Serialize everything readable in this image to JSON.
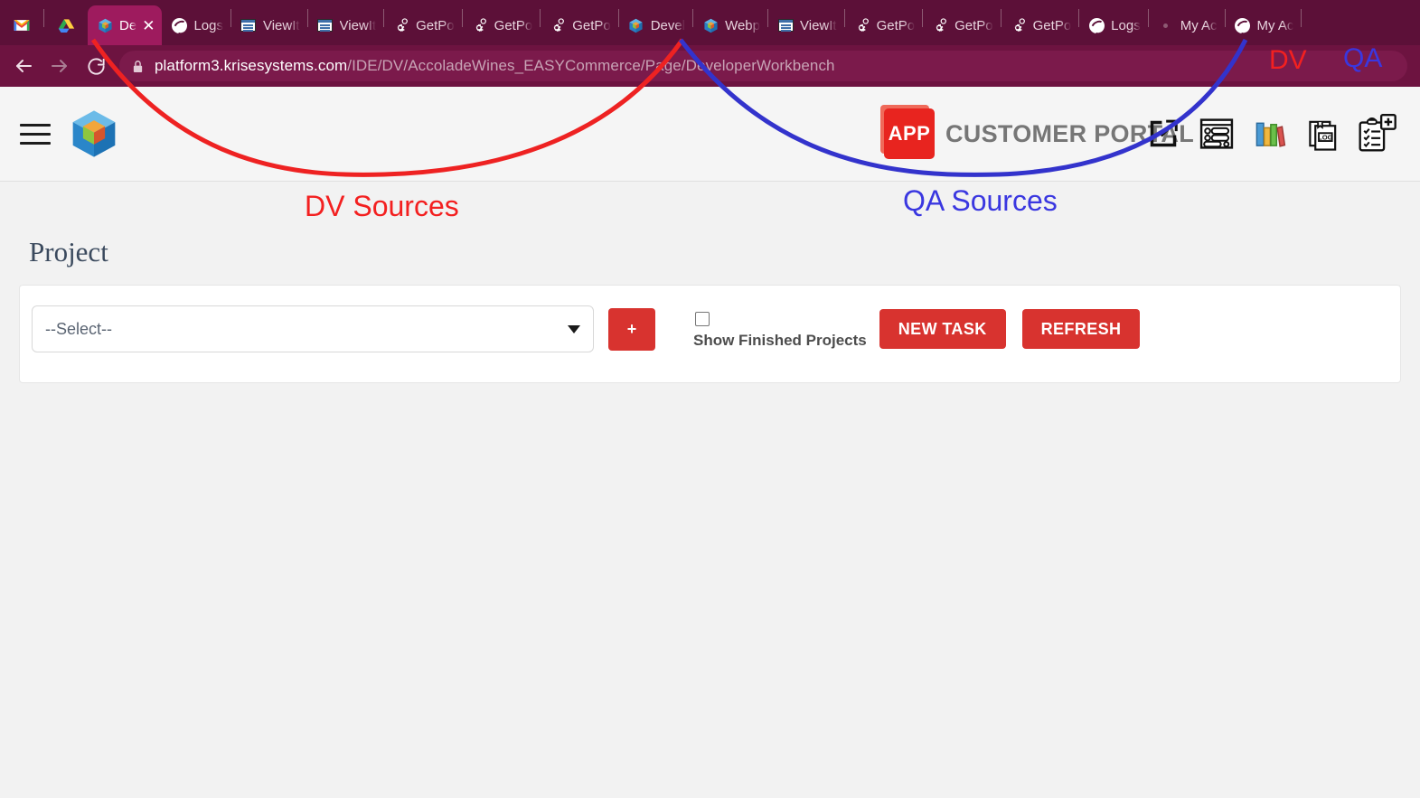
{
  "browser": {
    "quick_icons": [
      {
        "name": "gmail-icon",
        "label": "Gmail"
      },
      {
        "name": "google-drive-icon",
        "label": "Google Drive"
      }
    ],
    "tabs": [
      {
        "title": "De",
        "favicon": "cube-icon",
        "active": true,
        "has_close": true
      },
      {
        "title": "Logs",
        "favicon": "globe-icon",
        "active": false,
        "has_close": false
      },
      {
        "title": "ViewIt",
        "favicon": "window-icon",
        "active": false,
        "has_close": false
      },
      {
        "title": "ViewIt",
        "favicon": "window-icon",
        "active": false,
        "has_close": false
      },
      {
        "title": "GetPo",
        "favicon": "gear-icon",
        "active": false,
        "has_close": false
      },
      {
        "title": "GetPo",
        "favicon": "gear-icon",
        "active": false,
        "has_close": false
      },
      {
        "title": "GetPo",
        "favicon": "gear-icon",
        "active": false,
        "has_close": false
      },
      {
        "title": "Devel",
        "favicon": "cube-icon",
        "active": false,
        "has_close": false
      },
      {
        "title": "Webp",
        "favicon": "cube-icon",
        "active": false,
        "has_close": false
      },
      {
        "title": "ViewIt",
        "favicon": "window-icon",
        "active": false,
        "has_close": false
      },
      {
        "title": "GetPo",
        "favicon": "gear-icon",
        "active": false,
        "has_close": false
      },
      {
        "title": "GetPo",
        "favicon": "gear-icon",
        "active": false,
        "has_close": false
      },
      {
        "title": "GetPo",
        "favicon": "gear-icon",
        "active": false,
        "has_close": false
      },
      {
        "title": "Logs",
        "favicon": "globe-icon",
        "active": false,
        "has_close": false
      },
      {
        "title": "My Ac",
        "favicon": "dot-icon",
        "active": false,
        "has_close": false
      },
      {
        "title": "My Ac",
        "favicon": "globe-icon",
        "active": false,
        "has_close": false
      }
    ],
    "nav": {
      "back_label": "Back",
      "forward_label": "Forward",
      "reload_label": "Reload"
    },
    "omnibox": {
      "host": "platform3.krisesystems.com",
      "path": "/IDE/DV/AccoladeWines_EASYCommerce/Page/DeveloperWorkbench",
      "security_icon": "lock-icon"
    },
    "theme_color": "#5c1038"
  },
  "app_header": {
    "menu_icon": "hamburger-menu-icon",
    "logo_icon": "cube-logo-icon",
    "badge_text": "APP",
    "brand_title": "CUSTOMER PORTAL",
    "brand_title_color": "#767676",
    "badge_color": "#e8241f",
    "tools": [
      {
        "name": "open-external-icon",
        "label": "Open in new window"
      },
      {
        "name": "conversation-icon",
        "label": "Conversations"
      },
      {
        "name": "library-books-icon",
        "label": "Library"
      },
      {
        "name": "log-file-icon",
        "label": "LOG"
      },
      {
        "name": "new-checklist-icon",
        "label": "New checklist"
      }
    ]
  },
  "main": {
    "page_title": "Project",
    "project_select": {
      "value": "--Select--",
      "placeholder": "--Select--"
    },
    "add_button_label": "+",
    "finished_projects_label": "Show Finished Projects",
    "finished_projects_checked": false,
    "new_task_label": "NEW TASK",
    "refresh_label": "REFRESH",
    "accent_color": "#d8332f"
  },
  "annotations": {
    "dv_sources_label": "DV Sources",
    "qa_sources_label": "QA Sources",
    "dv_label": "DV",
    "qa_label": "QA",
    "dv_color": "#f32020",
    "qa_color": "#3a37e0"
  }
}
